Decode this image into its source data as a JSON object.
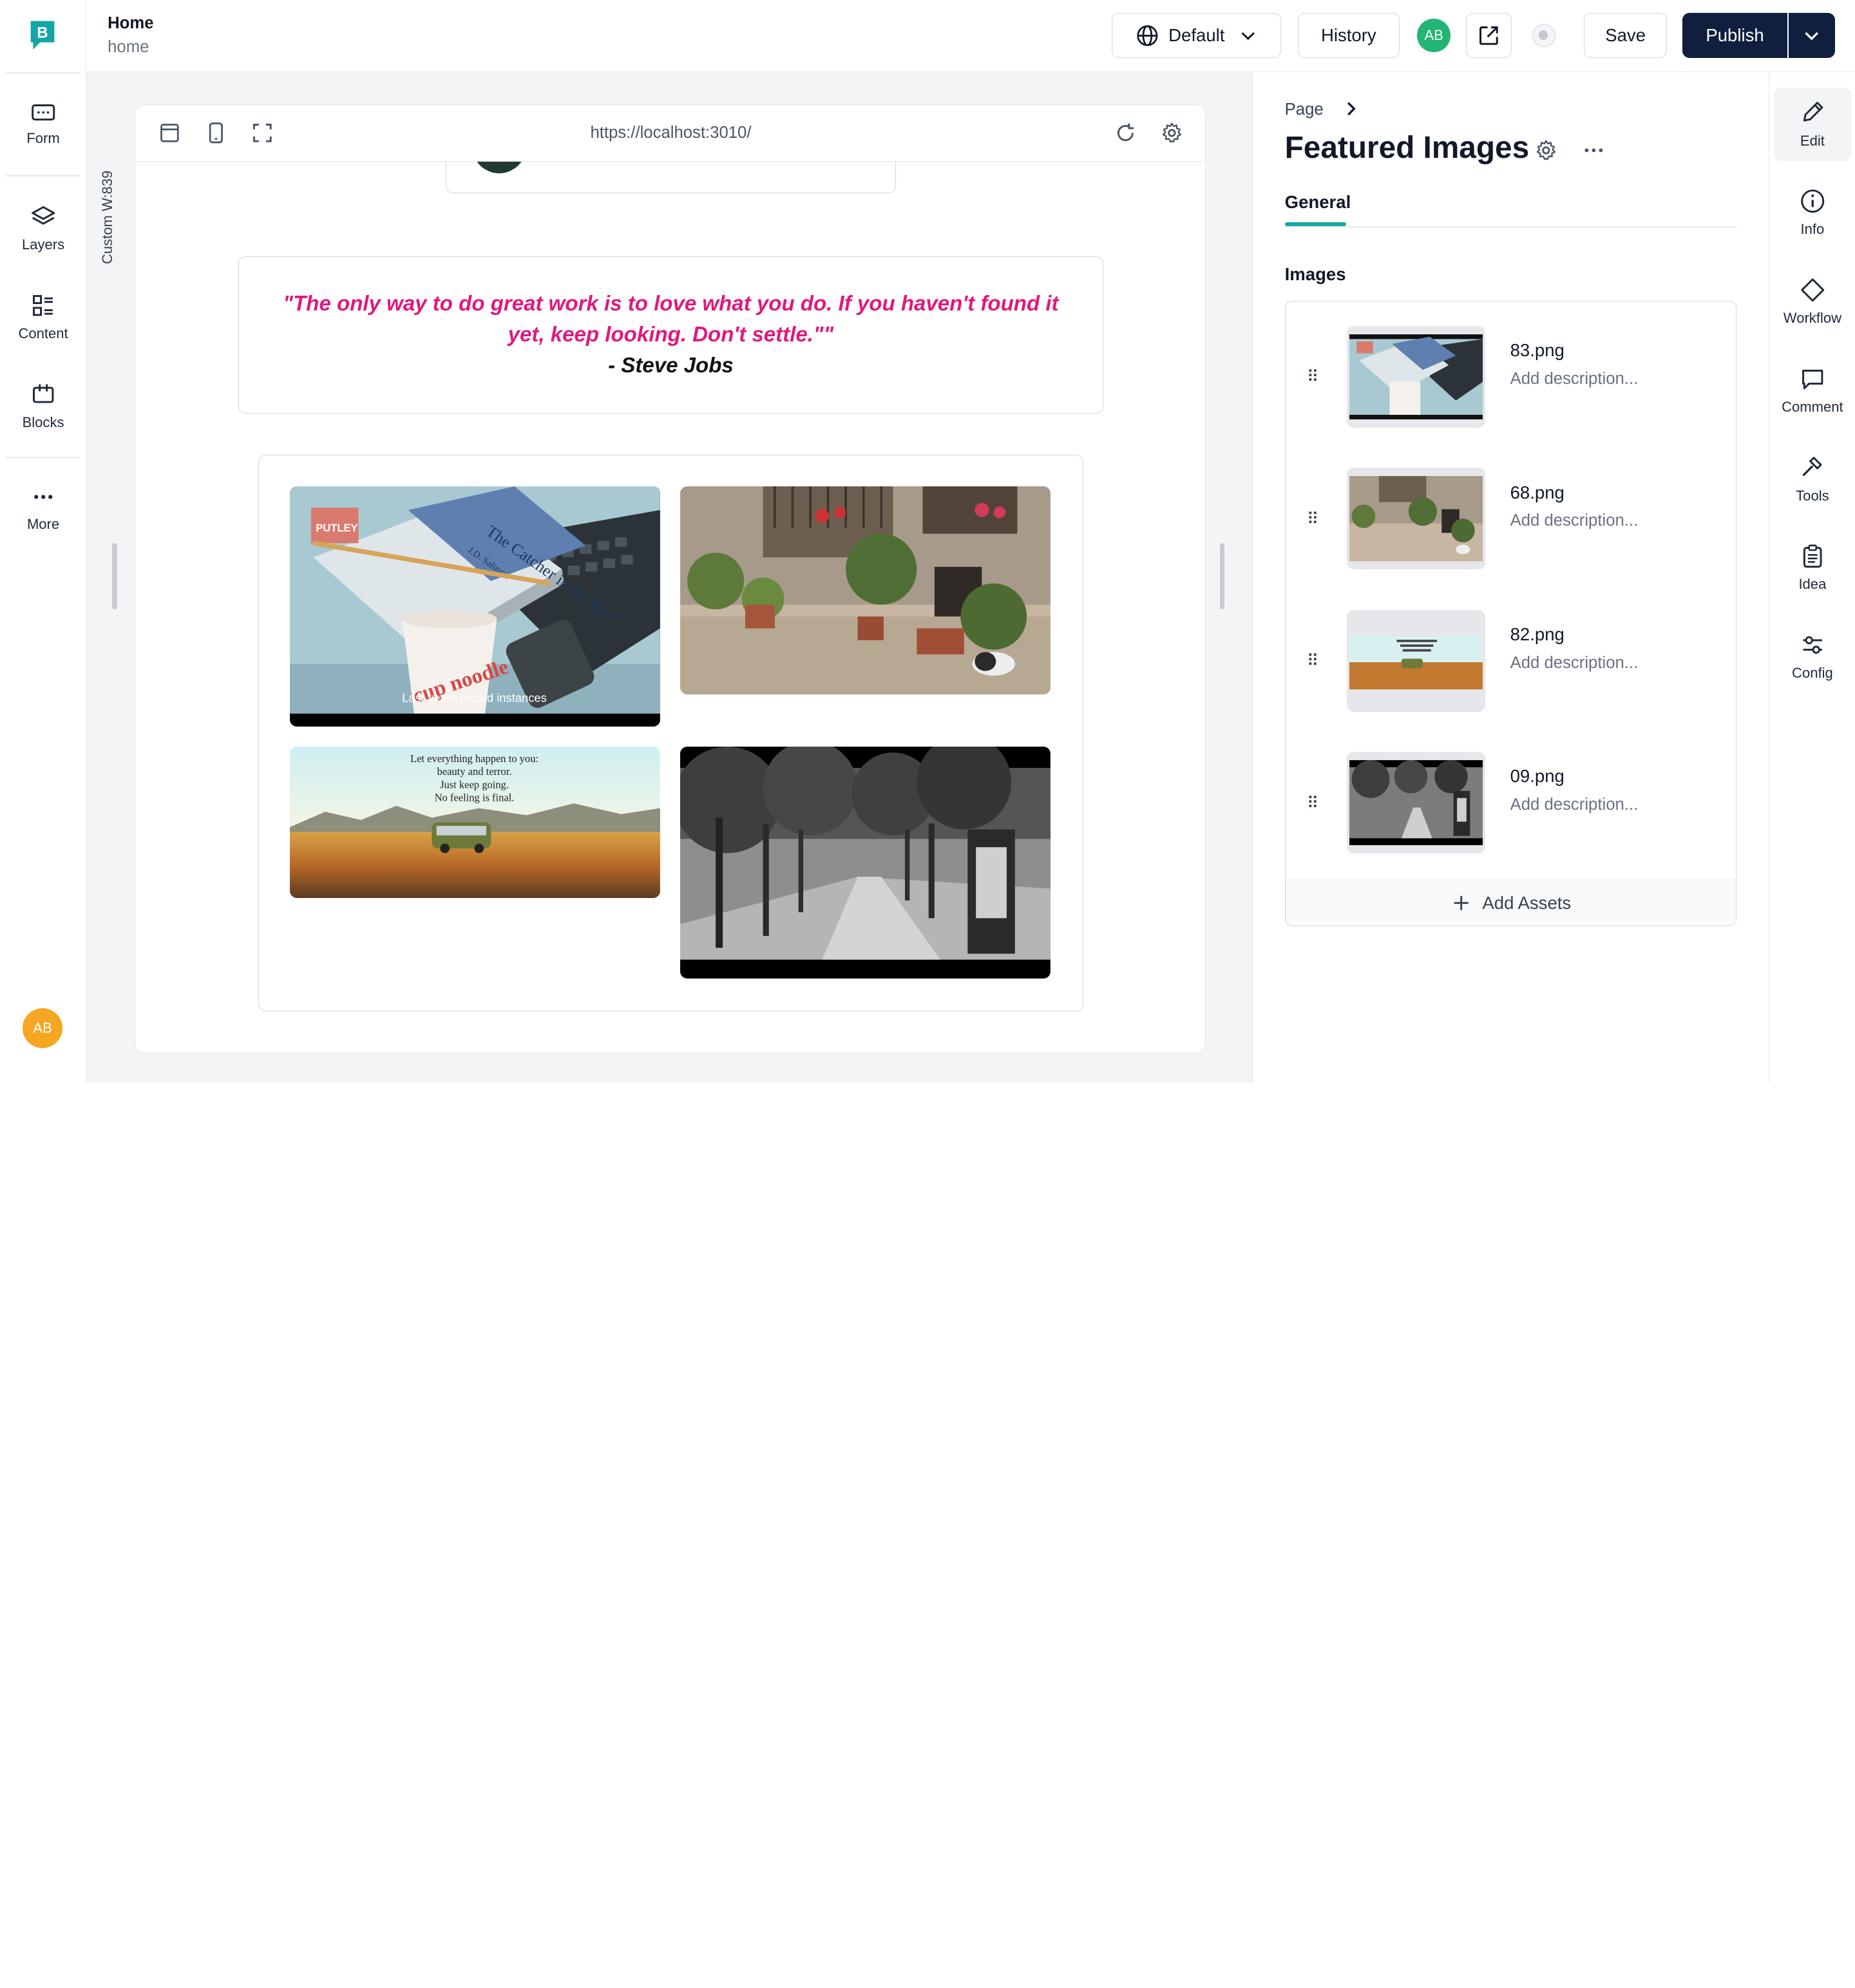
{
  "app": {
    "brand_color": "#14a6a6",
    "logo_letter": "B"
  },
  "left_rail": {
    "items": [
      {
        "label": "Form",
        "icon": "form-icon"
      },
      {
        "label": "Layers",
        "icon": "layers-icon"
      },
      {
        "label": "Content",
        "icon": "content-icon"
      },
      {
        "label": "Blocks",
        "icon": "blocks-icon"
      },
      {
        "label": "More",
        "icon": "more-icon"
      }
    ],
    "avatar": "AB",
    "avatar_color": "#f5a623"
  },
  "topbar": {
    "page_title": "Home",
    "page_slug": "home",
    "locale_label": "Default",
    "history_label": "History",
    "user_initials": "AB",
    "user_color": "#22b573",
    "save_label": "Save",
    "publish_label": "Publish",
    "publish_color": "#0f1f3d"
  },
  "canvas": {
    "width_label": "Custom W:839",
    "url": "https://localhost:3010/",
    "quote": {
      "text": "\"The only way to do great work is to love what you do. If you haven't found it yet, keep looking. Don't settle.\"\"",
      "author": "- Steve Jobs",
      "color": "#e0197d"
    },
    "gallery": [
      {
        "file": "83.png",
        "caption": "Last years record instances"
      },
      {
        "file": "68.png",
        "caption": ""
      },
      {
        "file": "82.png",
        "caption": "Let everything happen to you: beauty and terror. Just keep going. No feeling is final."
      },
      {
        "file": "09.png",
        "caption": ""
      }
    ],
    "images_83_text": {
      "book_title": "The Catcher in the Rye",
      "author": "J.D. Salinger",
      "cup_text": "cup noodle",
      "label": "PUTLEY"
    }
  },
  "panel": {
    "breadcrumb": "Page",
    "title": "Featured Images",
    "tabs": [
      {
        "label": "General",
        "active": true
      }
    ],
    "section_label": "Images",
    "images": [
      {
        "name": "83.png",
        "description_placeholder": "Add description..."
      },
      {
        "name": "68.png",
        "description_placeholder": "Add description..."
      },
      {
        "name": "82.png",
        "description_placeholder": "Add description..."
      },
      {
        "name": "09.png",
        "description_placeholder": "Add description..."
      }
    ],
    "add_assets_label": "Add Assets"
  },
  "right_rail": {
    "items": [
      {
        "label": "Edit",
        "icon": "pencil-icon",
        "active": true
      },
      {
        "label": "Info",
        "icon": "info-icon"
      },
      {
        "label": "Workflow",
        "icon": "diamond-icon"
      },
      {
        "label": "Comment",
        "icon": "comment-icon"
      },
      {
        "label": "Tools",
        "icon": "hammer-icon"
      },
      {
        "label": "Idea",
        "icon": "clipboard-icon"
      },
      {
        "label": "Config",
        "icon": "sliders-icon"
      }
    ]
  }
}
